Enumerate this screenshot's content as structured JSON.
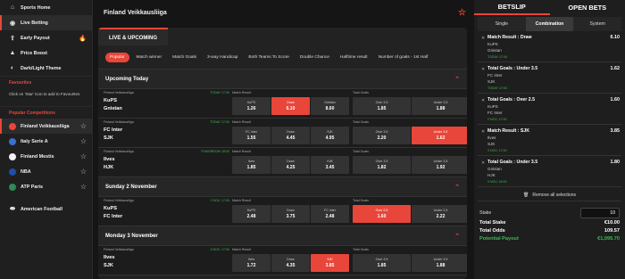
{
  "sidebar": {
    "top": [
      {
        "label": "Sports Home",
        "icon": "home-icon"
      },
      {
        "label": "Live Betting",
        "icon": "live-icon"
      },
      {
        "label": "Early Payout",
        "icon": "payout-icon"
      },
      {
        "label": "Price Boost",
        "icon": "boost-icon"
      },
      {
        "label": "Dark/Light Theme",
        "icon": "theme-icon"
      }
    ],
    "favourites_title": "Favourites",
    "favourites_note": "Click on 'Star' icon to add to Favourites",
    "popular_title": "Popular Competitions",
    "competitions": [
      {
        "label": "Finland Veikkausliiga",
        "color": "#e8463a"
      },
      {
        "label": "Italy Serie A",
        "color": "#3b6fd1"
      },
      {
        "label": "Finland Mestis",
        "color": "#f2f2f2"
      },
      {
        "label": "NBA",
        "color": "#1d4fa8"
      },
      {
        "label": "ATP Paris",
        "color": "#2e8b57"
      }
    ],
    "bottom": "American Football"
  },
  "main": {
    "title": "Finland Veikkausliiga",
    "panel_tab": "LIVE & UPCOMING",
    "filters": [
      "Popular",
      "Match winner",
      "Match Goals",
      "3-way Handicap",
      "Both Teams To Score",
      "Double Chance",
      "Halftime result",
      "Number of goals - 1st Half"
    ],
    "groups": [
      {
        "title": "Upcoming Today",
        "events": [
          {
            "league": "Finland Veikkausliiga",
            "date": "TODAY 17:00",
            "home": "KuPS",
            "away": "Gnistan",
            "m1": "Match Result",
            "o1": [
              {
                "l": "KuPS",
                "v": "1.26"
              },
              {
                "l": "Draw",
                "v": "6.10",
                "sel": true
              },
              {
                "l": "Gnistan",
                "v": "8.60"
              }
            ],
            "m2": "Total Goals",
            "o2": [
              {
                "l": "Over 3.5",
                "v": "1.85"
              },
              {
                "l": "Under 3.5",
                "v": "1.88"
              }
            ]
          },
          {
            "league": "Finland Veikkausliiga",
            "date": "TODAY 17:00",
            "home": "FC Inter",
            "away": "SJK",
            "m1": "Match Result",
            "o1": [
              {
                "l": "FC Inter",
                "v": "1.55"
              },
              {
                "l": "Draw",
                "v": "4.45"
              },
              {
                "l": "SJK",
                "v": "4.95"
              }
            ],
            "m2": "Total Goals",
            "o2": [
              {
                "l": "Over 3.5",
                "v": "2.20"
              },
              {
                "l": "Under 3.5",
                "v": "1.62",
                "sel": true
              }
            ]
          },
          {
            "league": "Finland Veikkausliiga",
            "date": "TOMORROW 18:00",
            "home": "Ilves",
            "away": "HJK",
            "m1": "Match Result",
            "o1": [
              {
                "l": "Ilves",
                "v": "1.85"
              },
              {
                "l": "Draw",
                "v": "4.25"
              },
              {
                "l": "HJK",
                "v": "3.45"
              }
            ],
            "m2": "Total Goals",
            "o2": [
              {
                "l": "Over 3.5",
                "v": "1.82"
              },
              {
                "l": "Under 3.5",
                "v": "1.92"
              }
            ]
          }
        ]
      },
      {
        "title": "Sunday  2 November",
        "events": [
          {
            "league": "Finland Veikkausliiga",
            "date": "2 NOV, 17:00",
            "home": "KuPS",
            "away": "FC Inter",
            "m1": "Match Result",
            "o1": [
              {
                "l": "KuPS",
                "v": "2.48"
              },
              {
                "l": "Draw",
                "v": "3.75"
              },
              {
                "l": "FC Inter",
                "v": "2.48"
              }
            ],
            "m2": "Total Goals",
            "o2": [
              {
                "l": "Over 2.5",
                "v": "1.60",
                "sel": true
              },
              {
                "l": "Under 2.5",
                "v": "2.22"
              }
            ]
          }
        ]
      },
      {
        "title": "Monday  3 November",
        "events": [
          {
            "league": "Finland Veikkausliiga",
            "date": "3 NOV, 17:00",
            "home": "Ilves",
            "away": "SJK",
            "m1": "Match Result",
            "o1": [
              {
                "l": "Ilves",
                "v": "1.72"
              },
              {
                "l": "Draw",
                "v": "4.35"
              },
              {
                "l": "SJK",
                "v": "3.85",
                "sel": true
              }
            ],
            "m2": "Total Goals",
            "o2": [
              {
                "l": "Over 3.5",
                "v": "1.85"
              },
              {
                "l": "Under 3.5",
                "v": "1.88"
              }
            ]
          }
        ]
      }
    ]
  },
  "betslip": {
    "tabs": [
      "BETSLIP",
      "OPEN BETS"
    ],
    "subtabs": [
      "Single",
      "Combination",
      "System"
    ],
    "selections": [
      {
        "market": "Match Result : Draw",
        "odd": "6.10",
        "home": "KuPS",
        "away": "Gnistan",
        "time": "TODAY 17:00"
      },
      {
        "market": "Total Goals : Under 3.5",
        "odd": "1.62",
        "home": "FC Inter",
        "away": "SJK",
        "time": "TODAY 17:00"
      },
      {
        "market": "Total Goals : Over 2.5",
        "odd": "1.60",
        "home": "KuPS",
        "away": "FC Inter",
        "time": "2 NOV, 17:00"
      },
      {
        "market": "Match Result : SJK",
        "odd": "3.85",
        "home": "Ilves",
        "away": "SJK",
        "time": "3 NOV, 17:00"
      },
      {
        "market": "Total Goals : Under 3.5",
        "odd": "1.80",
        "home": "Gnistan",
        "away": "HJK",
        "time": "3 NOV, 18:00"
      }
    ],
    "remove_all": "Remove all selections",
    "stake_label": "Stake",
    "stake_value": "10",
    "totals": [
      {
        "label": "Total Stake",
        "value": "€10.00"
      },
      {
        "label": "Total Odds",
        "value": "109.57"
      },
      {
        "label": "Potential Payout",
        "value": "€1,095.70",
        "green": true
      }
    ]
  }
}
